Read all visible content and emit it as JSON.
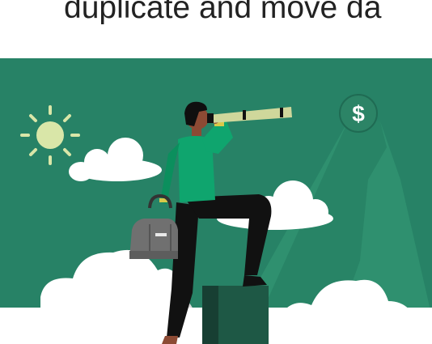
{
  "header": {
    "title": "duplicate and move da"
  },
  "illustration": {
    "coin_symbol": "$",
    "colors": {
      "background": "#278266",
      "mountain": "#2f906f",
      "mountain_shadow": "#237a5e",
      "sun": "#d9e6a8",
      "cloud": "#ffffff",
      "cloud_shadow": "#d8d8d8",
      "coin": "#2c8466",
      "sweater": "#0fa56e",
      "pants": "#111111",
      "skin": "#8c4a34",
      "hair": "#0f0f0f",
      "bag": "#707070",
      "telescope": "#cfd79b",
      "pedestal": "#1e5845",
      "pedestal_side": "#173f33"
    },
    "icons": [
      "sun-icon",
      "dollar-coin-icon",
      "telescope-icon",
      "handbag-icon"
    ]
  }
}
